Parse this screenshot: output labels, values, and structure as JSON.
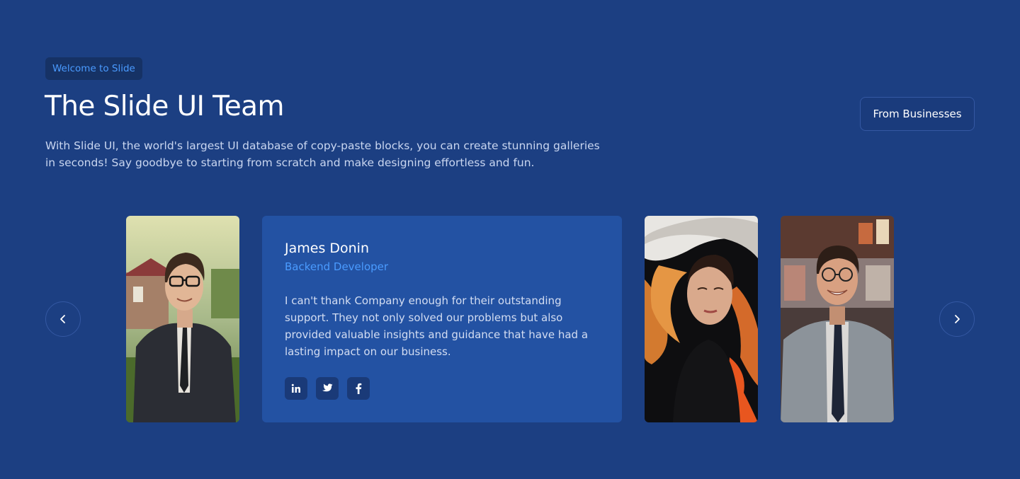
{
  "header": {
    "badge": "Welcome to Slide",
    "title": "The Slide UI Team",
    "subtitle": "With Slide UI, the world's largest UI database of copy-paste blocks, you can create stunning galleries in seconds! Say goodbye to starting from scratch and make designing effortless and fun.",
    "from_button": "From Businesses"
  },
  "carousel": {
    "prev_icon": "chevron-left-icon",
    "next_icon": "chevron-right-icon",
    "active": {
      "name": "James Donin",
      "role": "Backend Developer",
      "quote": "I can't thank Company enough for their outstanding support. They not only solved our problems but also provided valuable insights and guidance that have had a lasting impact on our business.",
      "socials": [
        "linkedin-icon",
        "twitter-icon",
        "facebook-icon"
      ]
    }
  },
  "colors": {
    "background": "#1c3f82",
    "card": "#2352a3",
    "accent": "#4a9bff"
  }
}
